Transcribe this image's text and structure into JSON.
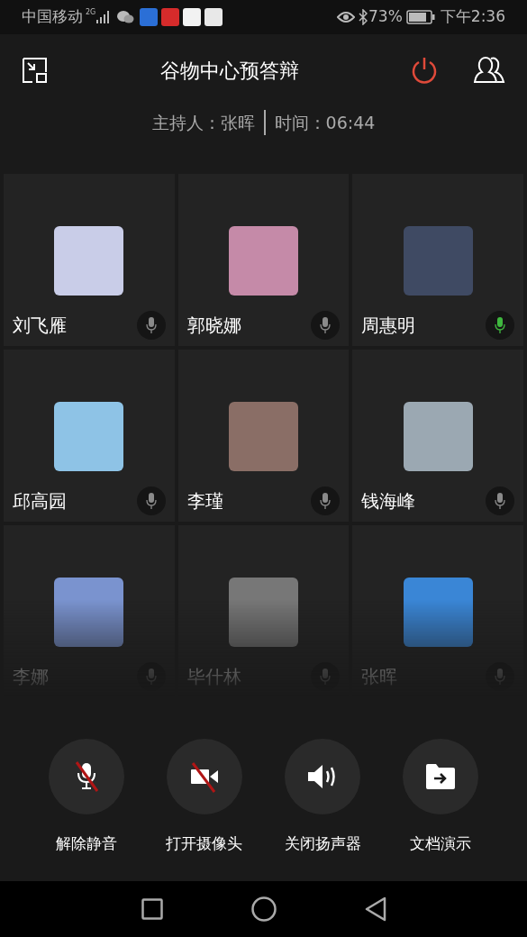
{
  "status_bar": {
    "carrier": "中国移动",
    "network": "2G",
    "battery": "73%",
    "time": "下午2:36"
  },
  "header": {
    "title": "谷物中心预答辩",
    "host": "主持人：张晖",
    "duration": "时间：06:44"
  },
  "participants": [
    {
      "name": "刘飞雁",
      "speaking": false
    },
    {
      "name": "郭晓娜",
      "speaking": false
    },
    {
      "name": "周惠明",
      "speaking": true
    },
    {
      "name": "邱高园",
      "speaking": false
    },
    {
      "name": "李瑾",
      "speaking": false
    },
    {
      "name": "钱海峰",
      "speaking": false
    },
    {
      "name": "李娜",
      "speaking": false
    },
    {
      "name": "毕什林",
      "speaking": false
    },
    {
      "name": "张晖",
      "speaking": false
    }
  ],
  "controls": [
    {
      "kind": "mic_off",
      "label": "解除静音"
    },
    {
      "kind": "camera_off",
      "label": "打开摄像头"
    },
    {
      "kind": "speaker",
      "label": "关闭扬声器"
    },
    {
      "kind": "share",
      "label": "文档演示"
    }
  ]
}
